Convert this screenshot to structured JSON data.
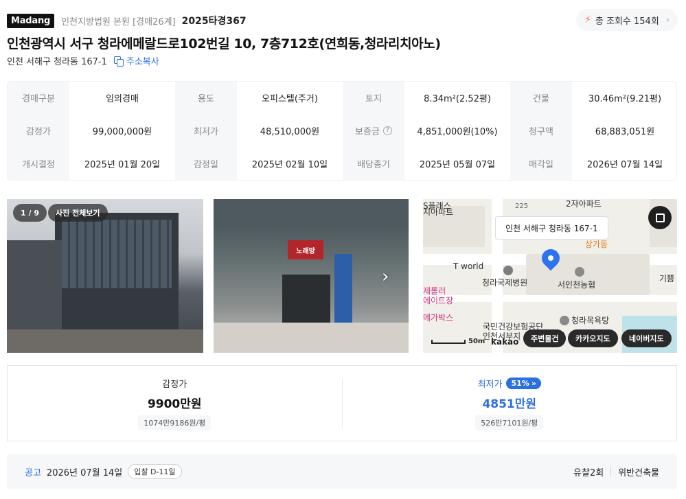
{
  "header": {
    "logo": "Madang",
    "court": "인천지방법원 본원 [경매26계]",
    "case_no": "2025타경367",
    "views": "총 조회수 154회",
    "title": "인천광역시 서구 청라에메랄드로102번길 10, 7층712호(연희동,청라리치아노)",
    "sub_address": "인천 서해구 청라동 167-1",
    "copy_label": "주소복사"
  },
  "info": {
    "row1": [
      {
        "label": "경매구분",
        "value": "임의경매"
      },
      {
        "label": "용도",
        "value": "오피스텔(주거)"
      },
      {
        "label": "토지",
        "value": "8.34m²(2.52평)"
      },
      {
        "label": "건물",
        "value": "30.46m²(9.21평)"
      }
    ],
    "row2": [
      {
        "label": "감정가",
        "value": "99,000,000원"
      },
      {
        "label": "최저가",
        "value": "48,510,000원"
      },
      {
        "label": "보증금",
        "value": "4,851,000원(10%)"
      },
      {
        "label": "청구액",
        "value": "68,883,051원"
      }
    ],
    "row3": [
      {
        "label": "개시결정",
        "value": "2025년 01월 20일"
      },
      {
        "label": "감정일",
        "value": "2025년 02월 10일"
      },
      {
        "label": "배당종기",
        "value": "2025년 05월 07일"
      },
      {
        "label": "매각일",
        "value": "2026년 07월 14일"
      }
    ]
  },
  "gallery": {
    "counter": "1 / 9",
    "view_all": "사진 전체보기",
    "sign_karaoke": "노래방"
  },
  "map": {
    "label": "인천 서해구 청라동 167-1",
    "places": {
      "tworld": "T world",
      "hospital": "청라국제병원",
      "bank": "서인천농협",
      "mall": "상가동",
      "bath": "청라목욕탕",
      "nhis": "국민건강보험공단",
      "nhis2": "인천서부지",
      "rollerskate": "제롤러",
      "rollerskate2": "에이트장",
      "megabox": "메가박스",
      "apt_top": "2자아파트",
      "apt_left": "지아파트",
      "num225": "225",
      "kipum": "기쁨"
    },
    "scale": "50m",
    "brand": "kakao",
    "btn_nearby": "주변물건",
    "btn_kakao": "카카오지도",
    "btn_naver": "네이버지도"
  },
  "price": {
    "appraisal_label": "감정가",
    "appraisal_value": "9900만원",
    "appraisal_per": "1074만9186원/평",
    "min_label": "최저가",
    "min_pct": "51%",
    "min_value": "4851만원",
    "min_per": "526만7101원/평"
  },
  "notice": {
    "tag": "공고",
    "date": "2026년 07월 14일",
    "pill": "입찰 D-11일",
    "fail_count": "유찰2회",
    "violation": "위반건축물"
  },
  "colors": {
    "accent": "#2b6fe0",
    "bolt": "#ff6a3d"
  }
}
